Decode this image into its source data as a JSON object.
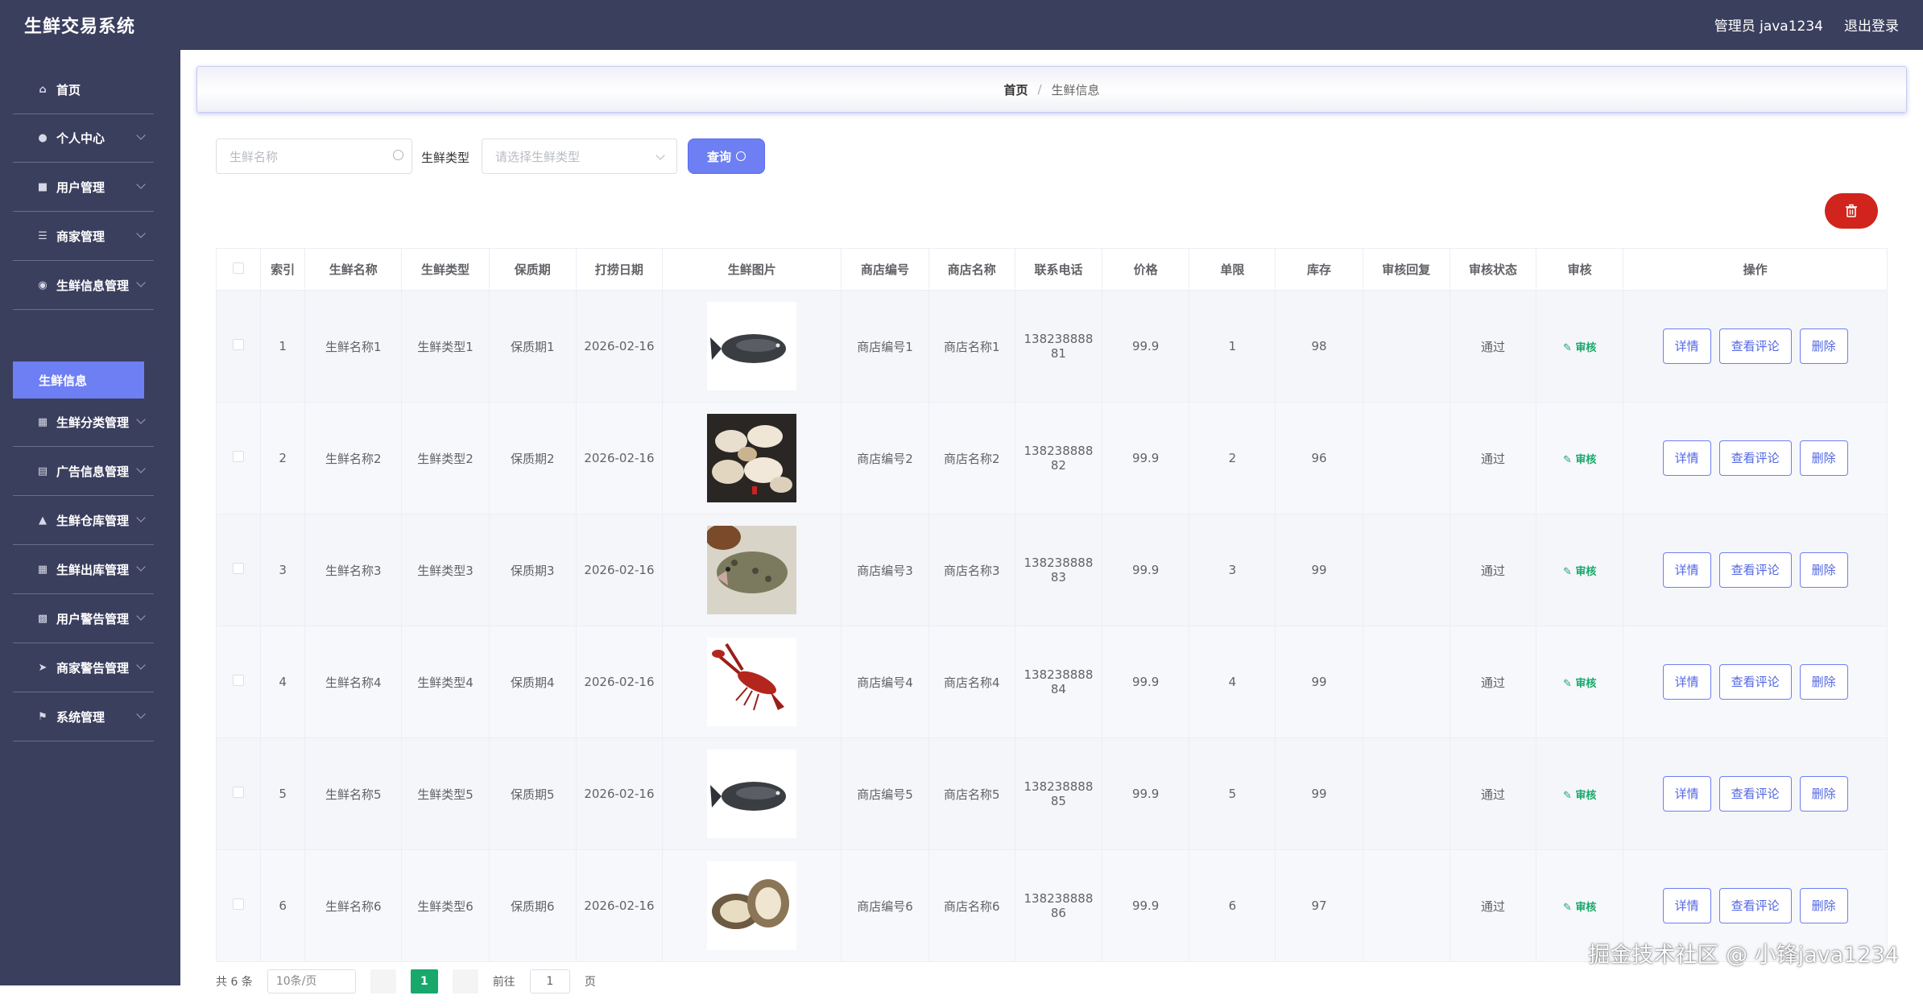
{
  "header": {
    "app_title": "生鲜交易系统",
    "admin_label": "管理员 java1234",
    "logout_label": "退出登录"
  },
  "sidebar": {
    "items": [
      {
        "label": "首页",
        "icon": "home-icon"
      },
      {
        "label": "个人中心",
        "icon": "user-icon"
      },
      {
        "label": "用户管理",
        "icon": "monitor-icon"
      },
      {
        "label": "商家管理",
        "icon": "list-icon"
      },
      {
        "label": "生鲜信息管理",
        "icon": "location-icon"
      },
      {
        "label": "生鲜分类管理",
        "icon": "grid-icon"
      },
      {
        "label": "广告信息管理",
        "icon": "document-icon"
      },
      {
        "label": "生鲜仓库管理",
        "icon": "trophy-icon"
      },
      {
        "label": "生鲜出库管理",
        "icon": "grid-icon"
      },
      {
        "label": "用户警告管理",
        "icon": "chat-icon"
      },
      {
        "label": "商家警告管理",
        "icon": "send-icon"
      },
      {
        "label": "系统管理",
        "icon": "flag-icon"
      }
    ],
    "active_sub": "生鲜信息"
  },
  "breadcrumb": {
    "home": "首页",
    "separator": "/",
    "current": "生鲜信息"
  },
  "search": {
    "name_placeholder": "生鲜名称",
    "type_label": "生鲜类型",
    "type_placeholder": "请选择生鲜类型",
    "query_label": "查询"
  },
  "table": {
    "columns": [
      "",
      "索引",
      "生鲜名称",
      "生鲜类型",
      "保质期",
      "打捞日期",
      "生鲜图片",
      "商店编号",
      "商店名称",
      "联系电话",
      "价格",
      "单限",
      "库存",
      "审核回复",
      "审核状态",
      "审核",
      "操作"
    ],
    "audit_link_label": "审核",
    "actions": {
      "detail": "详情",
      "comments": "查看评论",
      "delete": "删除"
    },
    "rows": [
      {
        "index": "1",
        "name": "生鲜名称1",
        "type": "生鲜类型1",
        "shelf_life": "保质期1",
        "date": "2026-02-16",
        "image": "fish-grey",
        "shop_no": "商店编号1",
        "shop_name": "商店名称1",
        "phone_a": "138238888",
        "phone_b": "81",
        "price": "99.9",
        "limit": "1",
        "stock": "98",
        "reply": "",
        "status": "通过"
      },
      {
        "index": "2",
        "name": "生鲜名称2",
        "type": "生鲜类型2",
        "shelf_life": "保质期2",
        "date": "2026-02-16",
        "image": "clams",
        "shop_no": "商店编号2",
        "shop_name": "商店名称2",
        "phone_a": "138238888",
        "phone_b": "82",
        "price": "99.9",
        "limit": "2",
        "stock": "96",
        "reply": "",
        "status": "通过"
      },
      {
        "index": "3",
        "name": "生鲜名称3",
        "type": "生鲜类型3",
        "shelf_life": "保质期3",
        "date": "2026-02-16",
        "image": "grouper",
        "shop_no": "商店编号3",
        "shop_name": "商店名称3",
        "phone_a": "138238888",
        "phone_b": "83",
        "price": "99.9",
        "limit": "3",
        "stock": "99",
        "reply": "",
        "status": "通过"
      },
      {
        "index": "4",
        "name": "生鲜名称4",
        "type": "生鲜类型4",
        "shelf_life": "保质期4",
        "date": "2026-02-16",
        "image": "crayfish",
        "shop_no": "商店编号4",
        "shop_name": "商店名称4",
        "phone_a": "138238888",
        "phone_b": "84",
        "price": "99.9",
        "limit": "4",
        "stock": "99",
        "reply": "",
        "status": "通过"
      },
      {
        "index": "5",
        "name": "生鲜名称5",
        "type": "生鲜类型5",
        "shelf_life": "保质期5",
        "date": "2026-02-16",
        "image": "fish-grey",
        "shop_no": "商店编号5",
        "shop_name": "商店名称5",
        "phone_a": "138238888",
        "phone_b": "85",
        "price": "99.9",
        "limit": "5",
        "stock": "99",
        "reply": "",
        "status": "通过"
      },
      {
        "index": "6",
        "name": "生鲜名称6",
        "type": "生鲜类型6",
        "shelf_life": "保质期6",
        "date": "2026-02-16",
        "image": "oysters",
        "shop_no": "商店编号6",
        "shop_name": "商店名称6",
        "phone_a": "138238888",
        "phone_b": "86",
        "price": "99.9",
        "limit": "6",
        "stock": "97",
        "reply": "",
        "status": "通过"
      }
    ]
  },
  "pagination": {
    "total": "共 6 条",
    "page_size": "10条/页",
    "current_page": "1",
    "goto_label": "前往",
    "goto_value": "1",
    "page_suffix": "页"
  },
  "watermark": "掘金技术社区 @ 小锋java1234",
  "colors": {
    "sidebar_bg": "#3b3f5e",
    "accent": "#6e7ff3",
    "danger": "#d0241c",
    "success": "#19a86b"
  }
}
